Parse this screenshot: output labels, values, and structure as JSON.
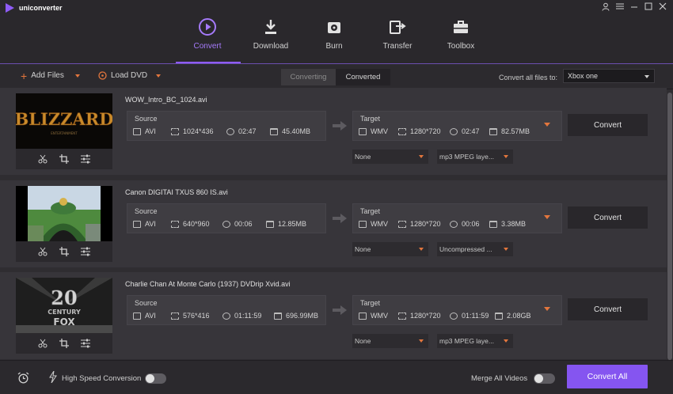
{
  "app": {
    "title": "uniconverter"
  },
  "window_controls": [
    "user-icon",
    "menu-icon",
    "minimize-icon",
    "maximize-icon",
    "close-icon"
  ],
  "nav": [
    {
      "label": "Convert",
      "icon": "play-circle-icon",
      "active": true
    },
    {
      "label": "Download",
      "icon": "download-icon",
      "active": false
    },
    {
      "label": "Burn",
      "icon": "disc-icon",
      "active": false
    },
    {
      "label": "Transfer",
      "icon": "transfer-icon",
      "active": false
    },
    {
      "label": "Toolbox",
      "icon": "toolbox-icon",
      "active": false
    }
  ],
  "toolbar": {
    "add_files": "Add Files",
    "load_dvd": "Load DVD",
    "tab_converting": "Converting",
    "tab_converted": "Converted",
    "convert_all_label": "Convert all files to:",
    "convert_all_value": "Xbox one"
  },
  "files": [
    {
      "name": "WOW_Intro_BC_1024.avi",
      "source": {
        "label": "Source",
        "format": "AVI",
        "resolution": "1024*436",
        "duration": "02:47",
        "size": "45.40MB"
      },
      "target": {
        "label": "Target",
        "format": "WMV",
        "resolution": "1280*720",
        "duration": "02:47",
        "size": "82.57MB"
      },
      "subtitle": "None",
      "audio": "mp3 MPEG laye...",
      "convert": "Convert"
    },
    {
      "name": "Canon DIGITAI TXUS 860 IS.avi",
      "source": {
        "label": "Source",
        "format": "AVI",
        "resolution": "640*960",
        "duration": "00:06",
        "size": "12.85MB"
      },
      "target": {
        "label": "Target",
        "format": "WMV",
        "resolution": "1280*720",
        "duration": "00:06",
        "size": "3.38MB"
      },
      "subtitle": "None",
      "audio": "Uncompressed ...",
      "convert": "Convert"
    },
    {
      "name": "Charlie Chan At Monte Carlo (1937) DVDrip Xvid.avi",
      "source": {
        "label": "Source",
        "format": "AVI",
        "resolution": "576*416",
        "duration": "01:11:59",
        "size": "696.99MB"
      },
      "target": {
        "label": "Target",
        "format": "WMV",
        "resolution": "1280*720",
        "duration": "01:11:59",
        "size": "2.08GB"
      },
      "subtitle": "None",
      "audio": "mp3 MPEG laye...",
      "convert": "Convert"
    }
  ],
  "bottom": {
    "high_speed": "High Speed Conversion",
    "merge": "Merge All Videos",
    "convert_all": "Convert All"
  },
  "colors": {
    "accent": "#8555f0",
    "orange": "#e3763d",
    "bg": "#2f2d31"
  }
}
